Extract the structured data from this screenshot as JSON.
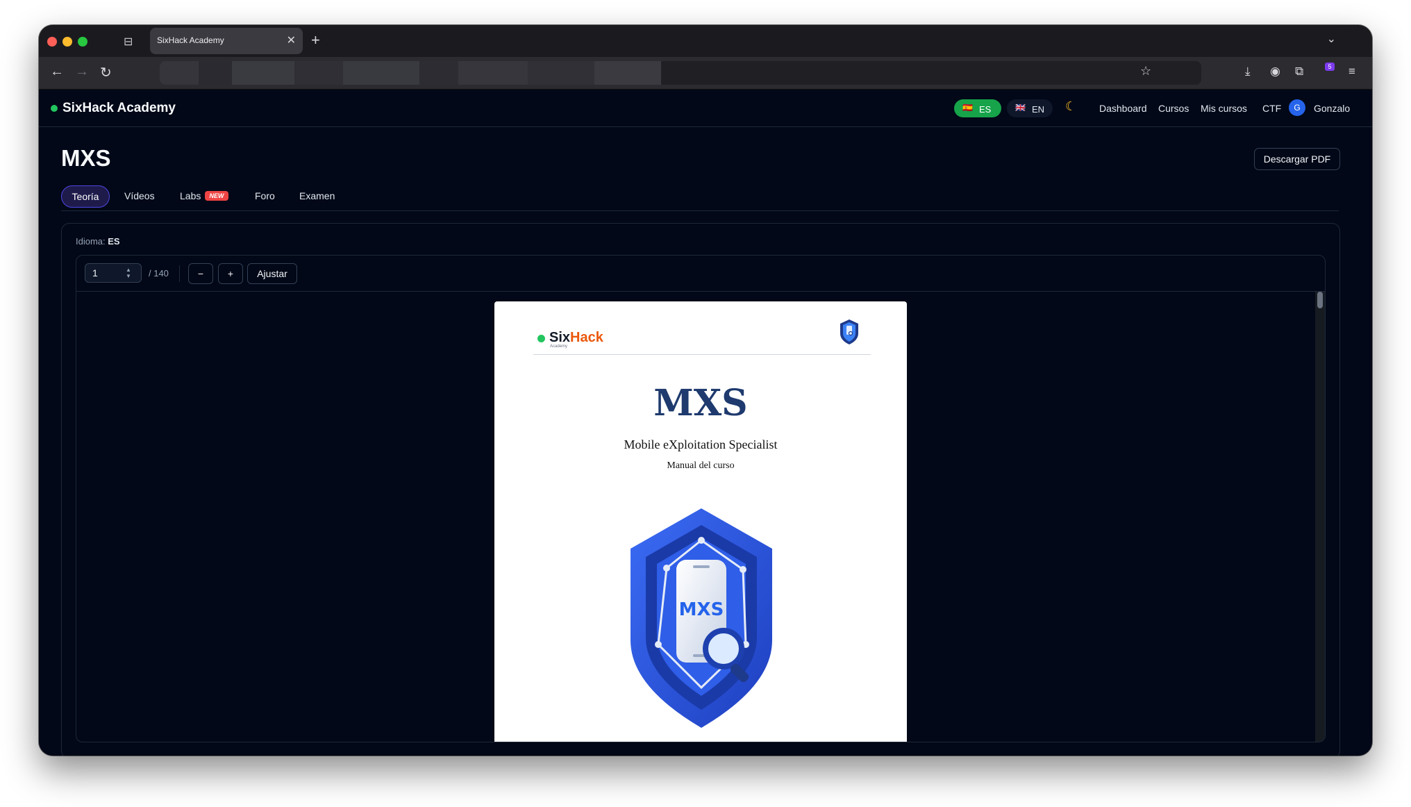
{
  "browser": {
    "tab_title": "SixHack Academy",
    "tab_close": "✕",
    "new_tab": "+",
    "tabs_menu": "⌄",
    "back": "←",
    "forward": "→",
    "reload": "↻",
    "bookmark": "☆",
    "download": "⤓",
    "account": "◉",
    "extensions": "⧉",
    "extension_badge": "5",
    "menu": "≡",
    "sidebar_toggle": "⊟"
  },
  "app": {
    "brand": "SixHack Academy",
    "lang_es": {
      "flag": "🇪🇸",
      "code": "ES"
    },
    "lang_en": {
      "flag": "🇬🇧",
      "code": "EN"
    },
    "theme_icon": "☾",
    "nav": [
      "Dashboard",
      "Cursos",
      "Mis cursos",
      "CTF"
    ],
    "user": {
      "initial": "G",
      "name": "Gonzalo"
    }
  },
  "course": {
    "title": "MXS",
    "download_label": "Descargar PDF",
    "tabs": [
      {
        "label": "Teoría",
        "active": true
      },
      {
        "label": "Vídeos"
      },
      {
        "label": "Labs",
        "badge": "NEW"
      },
      {
        "label": "Foro"
      },
      {
        "label": "Examen"
      }
    ],
    "language_label": "Idioma:",
    "language_value": "ES"
  },
  "viewer": {
    "page_value": "1",
    "total_pages": "/ 140",
    "zoom_out": "−",
    "zoom_in": "+",
    "fit": "Ajustar"
  },
  "pdf": {
    "logo_six": "Six",
    "logo_hack": "Hack",
    "logo_sub": "Academy",
    "title": "MXS",
    "subtitle": "Mobile eXploitation Specialist",
    "caption": "Manual del curso",
    "shield_text": "MXS"
  },
  "colors": {
    "accent": "#4f46e5",
    "success": "#16a34a",
    "brand_orange": "#ea580c",
    "pdf_title": "#1e3a6e",
    "background": "#020817"
  }
}
